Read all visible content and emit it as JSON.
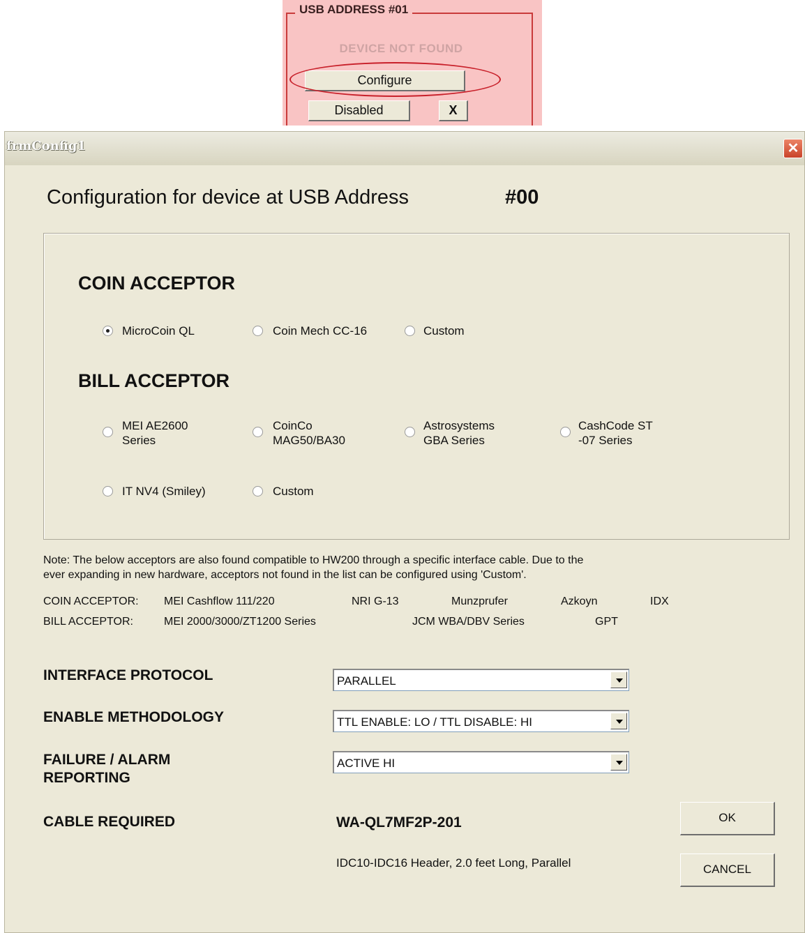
{
  "snippet": {
    "group_label": "USB ADDRESS #01",
    "status": "DEVICE NOT FOUND",
    "configure_label": "Configure",
    "disabled_label": "Disabled",
    "x_label": "X"
  },
  "dialog": {
    "title": "frmConfig1",
    "close_glyph": "✕",
    "heading": "Configuration for device at USB Address",
    "address": "#00"
  },
  "coin": {
    "title": "COIN ACCEPTOR",
    "options": [
      "MicroCoin QL",
      "Coin Mech CC-16",
      "Custom"
    ],
    "selected": "MicroCoin QL"
  },
  "bill": {
    "title": "BILL ACCEPTOR",
    "options": [
      {
        "line1": "MEI AE2600",
        "line2": "Series"
      },
      {
        "line1": "CoinCo",
        "line2": "MAG50/BA30"
      },
      {
        "line1": "Astrosystems",
        "line2": "GBA Series"
      },
      {
        "line1": "CashCode ST",
        "line2": "-07 Series"
      },
      {
        "line1": "IT NV4 (Smiley)",
        "line2": ""
      },
      {
        "line1": "Custom",
        "line2": ""
      }
    ]
  },
  "note": {
    "line1": "Note: The below acceptors are also found compatible to HW200 through a specific interface cable. Due to the",
    "line2": "ever expanding in new hardware,  acceptors not found in the list can be configured using 'Custom'.",
    "coin_row": {
      "label": "COIN ACCEPTOR:",
      "items": [
        "MEI Cashflow 111/220",
        "NRI G-13",
        "Munzprufer",
        "Azkoyn",
        "IDX"
      ]
    },
    "bill_row": {
      "label": "BILL ACCEPTOR:",
      "items": [
        "MEI 2000/3000/ZT1200 Series",
        "JCM WBA/DBV Series",
        "GPT"
      ]
    }
  },
  "fields": {
    "protocol": {
      "label": "INTERFACE PROTOCOL",
      "value": "PARALLEL"
    },
    "enable": {
      "label": "ENABLE METHODOLOGY",
      "value": "TTL ENABLE: LO / TTL DISABLE: HI"
    },
    "failure": {
      "label_line1": "FAILURE / ALARM",
      "label_line2": "REPORTING",
      "value": "ACTIVE HI"
    },
    "cable": {
      "label": "CABLE REQUIRED",
      "value": "WA-QL7MF2P-201",
      "description": "IDC10-IDC16 Header, 2.0 feet Long, Parallel"
    }
  },
  "buttons": {
    "ok": "OK",
    "cancel": "CANCEL"
  }
}
